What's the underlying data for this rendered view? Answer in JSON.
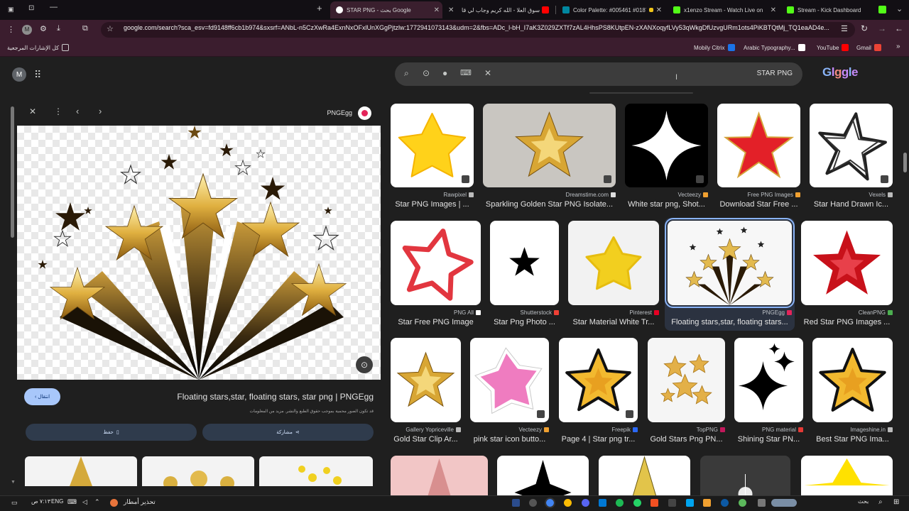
{
  "tabs": [
    {
      "title": "STAR PNG - بحث Google",
      "active": true,
      "favicon_color": "#4285f4"
    },
    {
      "title": "سوق العلا - الله كريم وجاب لي قا",
      "favicon_color": "#ff0000"
    },
    {
      "title": "Color Palette: #005461 #0187!",
      "favicon_color": "#0187a0"
    },
    {
      "title": "x1enzo Stream - Watch Live on",
      "favicon_color": "#53fc18"
    },
    {
      "title": "Stream - Kick Dashboard",
      "favicon_color": "#53fc18"
    }
  ],
  "address": {
    "url": "google.com/search?sca_esv=fd9148ff6cb1b974&sxsrf=ANbL-n5CzXwRa4ExnNxOFxlUnXGgPjtzlw:1772941073143&udm=2&fbs=ADc_l-bH_I7aK3Z029ZXTf7zAL4HhsPS8KUtpEN-zXANXoqyfLVy53qWkgDfUzvgURm1ots4PiKBTQtMj_TQ1eaAD4e..."
  },
  "bookmarks": {
    "all_label": "كل الإشارات المرجعية",
    "items": [
      {
        "label": "Mobily Citrix",
        "color": "#1a73e8"
      },
      {
        "label": "Arabic Typography...",
        "color": "#ffffff"
      },
      {
        "label": "YouTube",
        "color": "#ff0000"
      },
      {
        "label": "Gmail",
        "color": "#ea4335"
      }
    ]
  },
  "header": {
    "avatar_letter": "M",
    "query": "STAR PNG",
    "logo_letters": [
      "G",
      "l",
      "g",
      "g",
      "l",
      "e"
    ]
  },
  "preview": {
    "source": "PNGEgg",
    "title": "Floating stars,star, floating stars, star png | PNGEgg",
    "note": "قد تكون الصور محمية بموجب حقوق الطبع والنشر. مزيد من المعلومات",
    "visit": "انتقال",
    "save": "حفظ",
    "share": "مشاركة"
  },
  "results": [
    {
      "source": "Rawpixel",
      "title": "Star PNG Images | ...",
      "star": "yellow3d",
      "bg": "#ffffff",
      "icon": "#bbbbbb"
    },
    {
      "source": "Dreamstime.com",
      "title": "Sparkling Golden Star PNG Isolate...",
      "star": "gold",
      "bg": "#c9c6c1",
      "icon": "#dddddd"
    },
    {
      "source": "Vecteezy",
      "title": "White star png, Shot...",
      "star": "sparkle-white",
      "bg": "#000000",
      "icon": "#f0a030"
    },
    {
      "source": "Free PNG Images",
      "title": "Download Star Free ...",
      "star": "red",
      "bg": "#ffffff",
      "icon": "#f0a030"
    },
    {
      "source": "Vexels",
      "title": "Star Hand Drawn Ic...",
      "star": "scribble",
      "bg": "#ffffff",
      "icon": "#bbbbbb"
    },
    {
      "source": "PNG All",
      "title": "Star Free PNG Image",
      "star": "outline-red",
      "bg": "#ffffff",
      "icon": "#ffffff"
    },
    {
      "source": "Shutterstock",
      "title": "Star Png Photo ...",
      "star": "black",
      "bg": "#ffffff",
      "icon": "#ee4035"
    },
    {
      "source": "Pinterest",
      "title": "Star Material White Tr...",
      "star": "yellow-flat",
      "bg": "#f2f2f2",
      "icon": "#e60023"
    },
    {
      "source": "PNGEgg",
      "title": "Floating stars,star, floating stars...",
      "star": "floating",
      "bg": "#f7f7f7",
      "icon": "#e4245a"
    },
    {
      "source": "CleanPNG",
      "title": "Red Star PNG Images ...",
      "star": "red3d",
      "bg": "#ffffff",
      "icon": "#4caf50"
    },
    {
      "source": "Gallery Yopriceville",
      "title": "Gold Star Clip Ar...",
      "star": "gold",
      "bg": "#ffffff",
      "icon": "#bbbbbb"
    },
    {
      "source": "Vecteezy",
      "title": "pink star icon butto...",
      "star": "pink",
      "bg": "#ffffff",
      "icon": "#f0a030"
    },
    {
      "source": "Freepik",
      "title": "Page 4 | Star png tr...",
      "star": "gold-outline",
      "bg": "#ffffff",
      "icon": "#2b68f6"
    },
    {
      "source": "TopPNG",
      "title": "Gold Stars Png PN...",
      "star": "multi-gold",
      "bg": "#f5f5f5",
      "icon": "#c2185b"
    },
    {
      "source": "PNG material",
      "title": "Shining Star PN...",
      "star": "sparkle-black",
      "bg": "#ffffff",
      "icon": "#e53935"
    },
    {
      "source": "Imageshine.in",
      "title": "Best Star PNG Ima...",
      "star": "gold-outline",
      "bg": "#ffffff",
      "icon": "#bbbbbb"
    }
  ],
  "taskbar": {
    "weather": "تحذير أمطار",
    "lang": "ENG",
    "time": "٧:١٣ ص",
    "search": "بحث"
  }
}
